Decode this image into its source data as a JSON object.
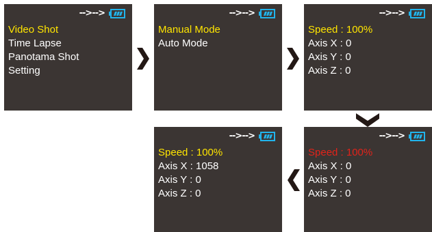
{
  "colors": {
    "screen_bg": "#3b3533",
    "text": "#ffffff",
    "highlight": "#ffe500",
    "active_red": "#e2231a",
    "battery": "#21b4ec",
    "arrow": "#231815"
  },
  "status": {
    "connection": "-->-->"
  },
  "screens": [
    {
      "lines": [
        "Video Shot",
        "Time Lapse",
        "Panotama Shot",
        "Setting"
      ]
    },
    {
      "lines": [
        "Manual Mode",
        "Auto Mode"
      ]
    },
    {
      "lines": [
        "Speed : 100%",
        "Axis X : 0",
        "Axis Y : 0",
        "Axis Z : 0"
      ]
    },
    {
      "lines": [
        "Speed : 100%",
        "Axis X : 0",
        "Axis Y : 0",
        "Axis Z : 0"
      ]
    },
    {
      "lines": [
        "Speed : 100%",
        "Axis X : 1058",
        "Axis Y : 0",
        "Axis Z : 0"
      ]
    }
  ],
  "arrows": [
    "arrow-right",
    "arrow-right",
    "arrow-down",
    "arrow-left"
  ]
}
